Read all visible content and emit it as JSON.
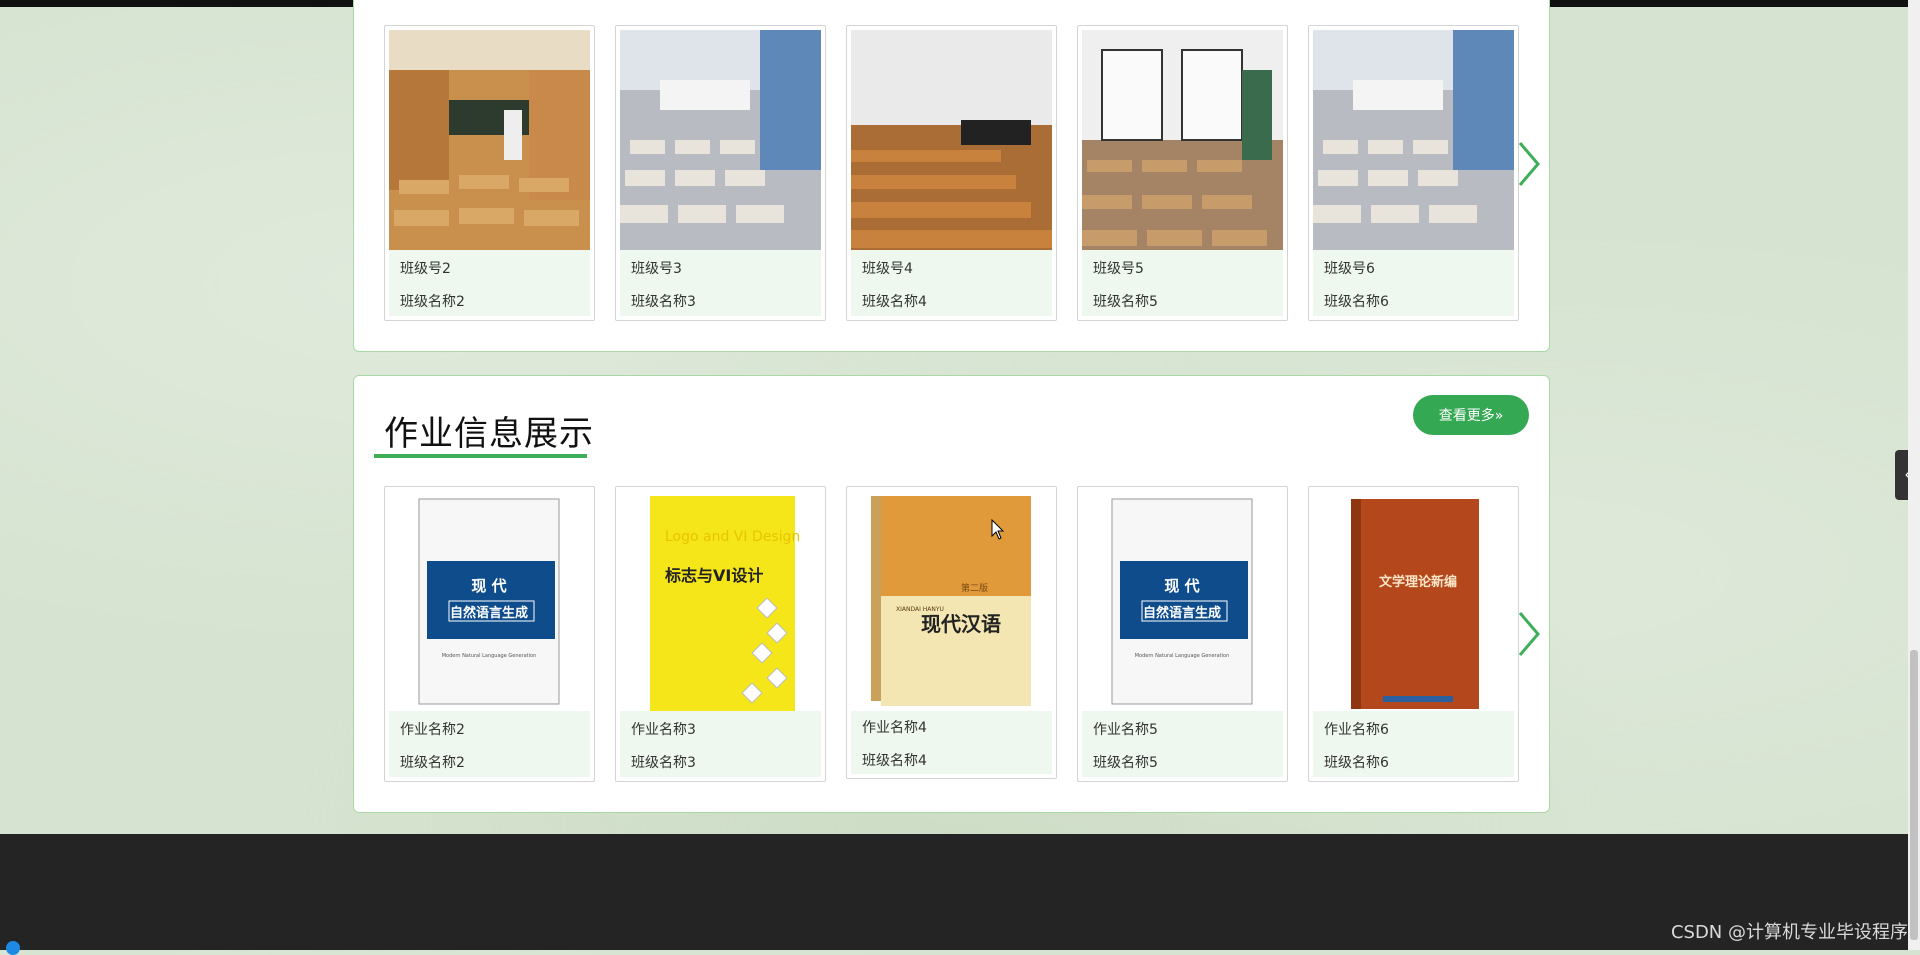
{
  "classes": {
    "items": [
      {
        "line1": "班级号2",
        "line2": "班级名称2"
      },
      {
        "line1": "班级号3",
        "line2": "班级名称3"
      },
      {
        "line1": "班级号4",
        "line2": "班级名称4"
      },
      {
        "line1": "班级号5",
        "line2": "班级名称5"
      },
      {
        "line1": "班级号6",
        "line2": "班级名称6"
      }
    ]
  },
  "homework": {
    "title": "作业信息展示",
    "more_label": "查看更多»",
    "items": [
      {
        "line1": "作业名称2",
        "line2": "班级名称2"
      },
      {
        "line1": "作业名称3",
        "line2": "班级名称3"
      },
      {
        "line1": "作业名称4",
        "line2": "班级名称4"
      },
      {
        "line1": "作业名称5",
        "line2": "班级名称5"
      },
      {
        "line1": "作业名称6",
        "line2": "班级名称6"
      }
    ],
    "book_covers": [
      {
        "top_text": "现 代",
        "main_text": "自然语言生成",
        "sub_text": "Modern Natural Language Generation"
      },
      {
        "top_text": "Logo and VI Design",
        "main_text": "标志与VI设计",
        "sub_text": ""
      },
      {
        "top_text": "第二版",
        "main_text": "现代汉语",
        "sub_text": "XIANDAI HANYU"
      },
      {
        "top_text": "现 代",
        "main_text": "自然语言生成",
        "sub_text": "Modern Natural Language Generation"
      },
      {
        "top_text": "",
        "main_text": "文学理论新编",
        "sub_text": ""
      }
    ]
  },
  "side_tab": {
    "label": "‹"
  },
  "watermark": {
    "text": "CSDN @计算机专业毕设程序"
  },
  "colors": {
    "accent": "#35a854",
    "card_info_bg": "#eef8ee",
    "footer_bg": "#242424"
  }
}
